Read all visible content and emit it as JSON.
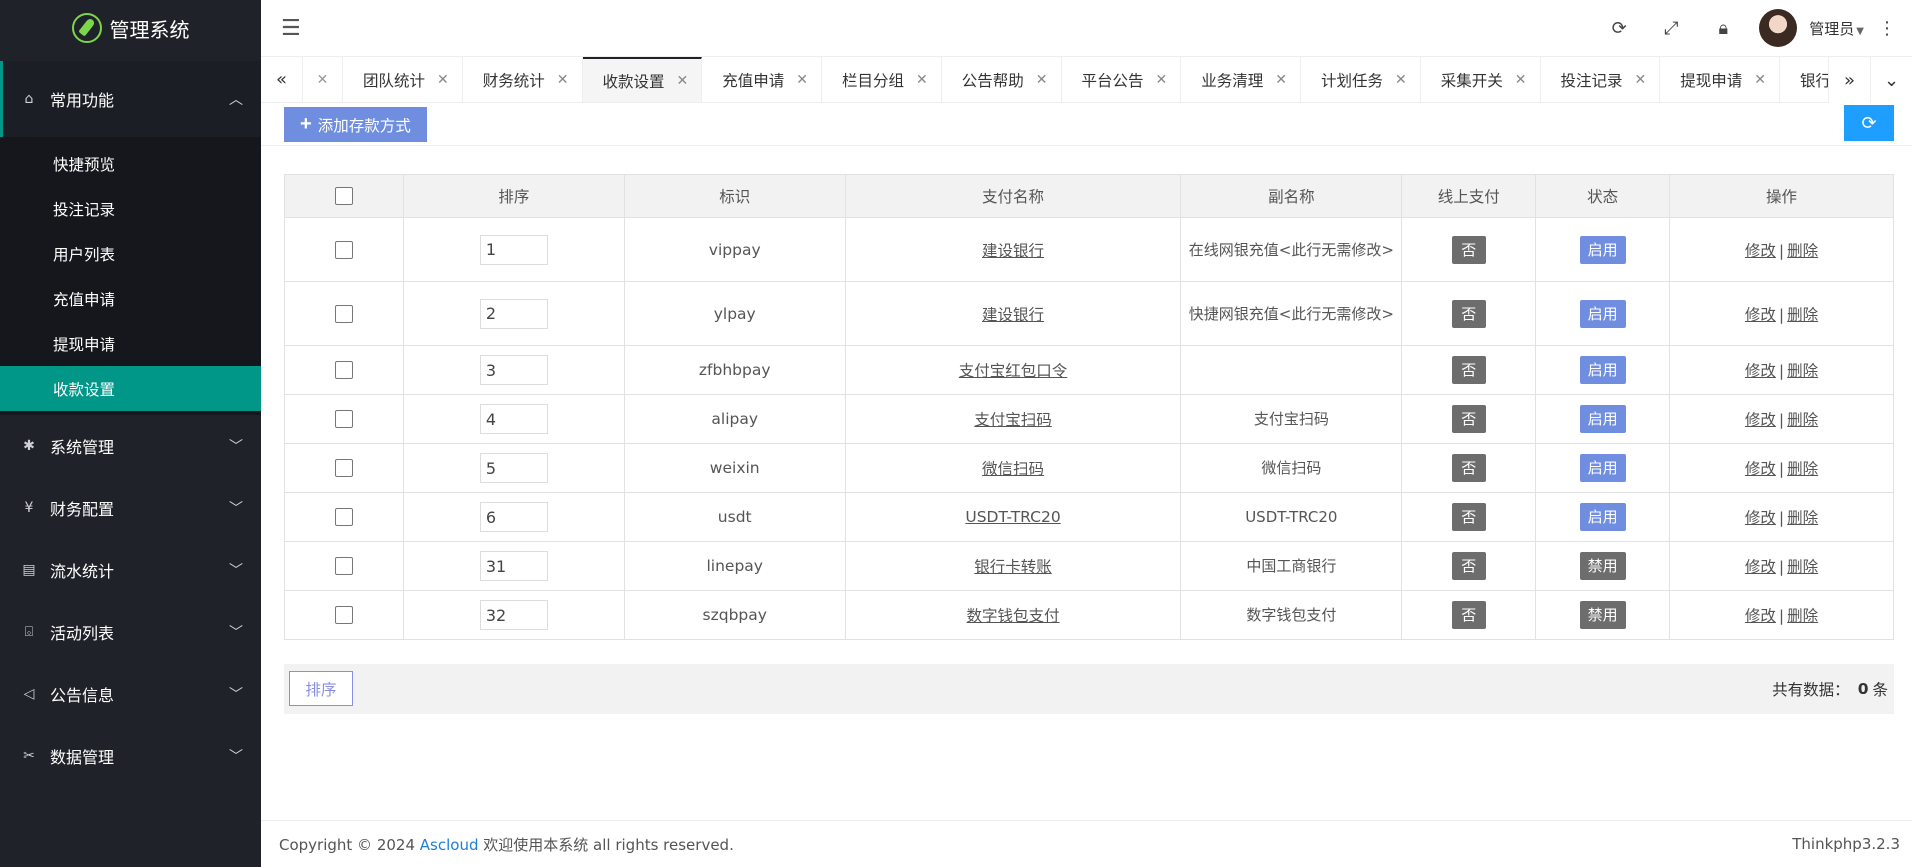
{
  "app": {
    "title": "管理系统"
  },
  "sidebar": {
    "groups": [
      {
        "label": "常用功能",
        "icon": "home-icon",
        "open": true,
        "items": [
          "快捷预览",
          "投注记录",
          "用户列表",
          "充值申请",
          "提现申请",
          "收款设置"
        ],
        "active": "收款设置"
      },
      {
        "label": "系统管理",
        "icon": "gear-icon"
      },
      {
        "label": "财务配置",
        "icon": "yen-icon"
      },
      {
        "label": "流水统计",
        "icon": "clipboard-icon"
      },
      {
        "label": "活动列表",
        "icon": "gift-icon"
      },
      {
        "label": "公告信息",
        "icon": "speaker-icon"
      },
      {
        "label": "数据管理",
        "icon": "tools-icon"
      }
    ]
  },
  "header": {
    "user": "管理员"
  },
  "tabs": [
    "团队统计",
    "财务统计",
    "收款设置",
    "充值申请",
    "栏目分组",
    "公告帮助",
    "平台公告",
    "业务清理",
    "计划任务",
    "采集开关",
    "投注记录",
    "提现申请",
    "银行列表"
  ],
  "active_tab": "收款设置",
  "toolbar": {
    "add_label": "添加存款方式"
  },
  "table": {
    "headers": [
      "排序",
      "标识",
      "支付名称",
      "副名称",
      "线上支付",
      "状态",
      "操作"
    ],
    "rows": [
      {
        "sort": "1",
        "code": "vippay",
        "name": "建设银行",
        "sub": "在线网银充值<此行无需修改>",
        "online": "否",
        "status": "启用"
      },
      {
        "sort": "2",
        "code": "ylpay",
        "name": "建设银行",
        "sub": "快捷网银充值<此行无需修改>",
        "online": "否",
        "status": "启用"
      },
      {
        "sort": "3",
        "code": "zfbhbpay",
        "name": "支付宝红包口令",
        "sub": "",
        "online": "否",
        "status": "启用"
      },
      {
        "sort": "4",
        "code": "alipay",
        "name": "支付宝扫码",
        "sub": "支付宝扫码",
        "online": "否",
        "status": "启用"
      },
      {
        "sort": "5",
        "code": "weixin",
        "name": "微信扫码",
        "sub": "微信扫码",
        "online": "否",
        "status": "启用"
      },
      {
        "sort": "6",
        "code": "usdt",
        "name": "USDT-TRC20",
        "sub": "USDT-TRC20",
        "online": "否",
        "status": "启用"
      },
      {
        "sort": "31",
        "code": "linepay",
        "name": "银行卡转账",
        "sub": "中国工商银行",
        "online": "否",
        "status": "禁用"
      },
      {
        "sort": "32",
        "code": "szqbpay",
        "name": "数字钱包支付",
        "sub": "数字钱包支付",
        "online": "否",
        "status": "禁用"
      }
    ],
    "ops": {
      "edit": "修改",
      "sep": "|",
      "delete": "删除"
    }
  },
  "bottom": {
    "sort_label": "排序",
    "total_label": "共有数据：",
    "total_value": "0",
    "total_unit": "条"
  },
  "footer": {
    "copyright": "Copyright © 2024",
    "brand": "Ascloud",
    "rest": "欢迎使用本系统 all rights reserved.",
    "version": "Thinkphp3.2.3"
  },
  "colors": {
    "sidebar_bg": "#20222a",
    "active_teal": "#009688",
    "enable_badge": "#6f8ee0",
    "disable_badge": "#6d6d6d",
    "refresh_btn": "#1e9fff"
  }
}
